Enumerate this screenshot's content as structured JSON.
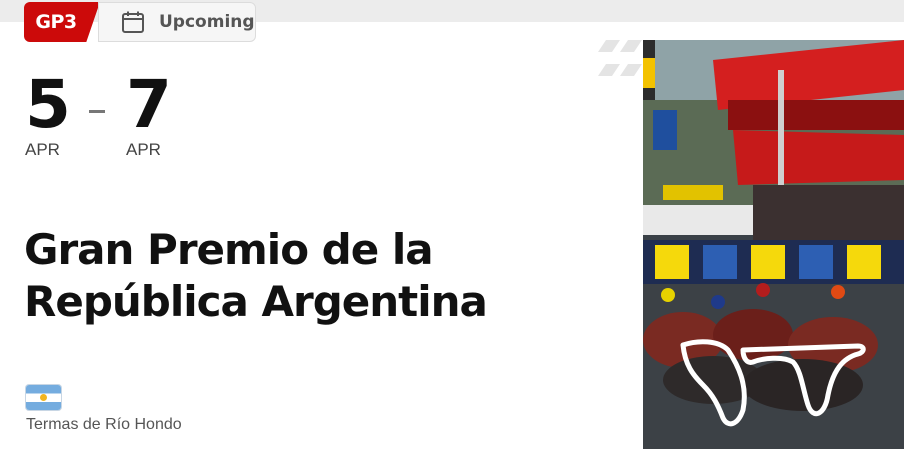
{
  "badge": {
    "round_label": "GP3",
    "status_label": "Upcoming",
    "status_icon": "calendar-icon"
  },
  "dates": {
    "start_day": "5",
    "start_month": "APR",
    "separator": "–",
    "end_day": "7",
    "end_month": "APR"
  },
  "event": {
    "title_line1": "Gran Premio de la",
    "title_line2": "República Argentina",
    "location": "Termas de Río Hondo",
    "flag_icon": "argentina-flag-icon"
  },
  "colors": {
    "accent_red": "#cc0a0a",
    "track_outline": "#ffffff"
  }
}
